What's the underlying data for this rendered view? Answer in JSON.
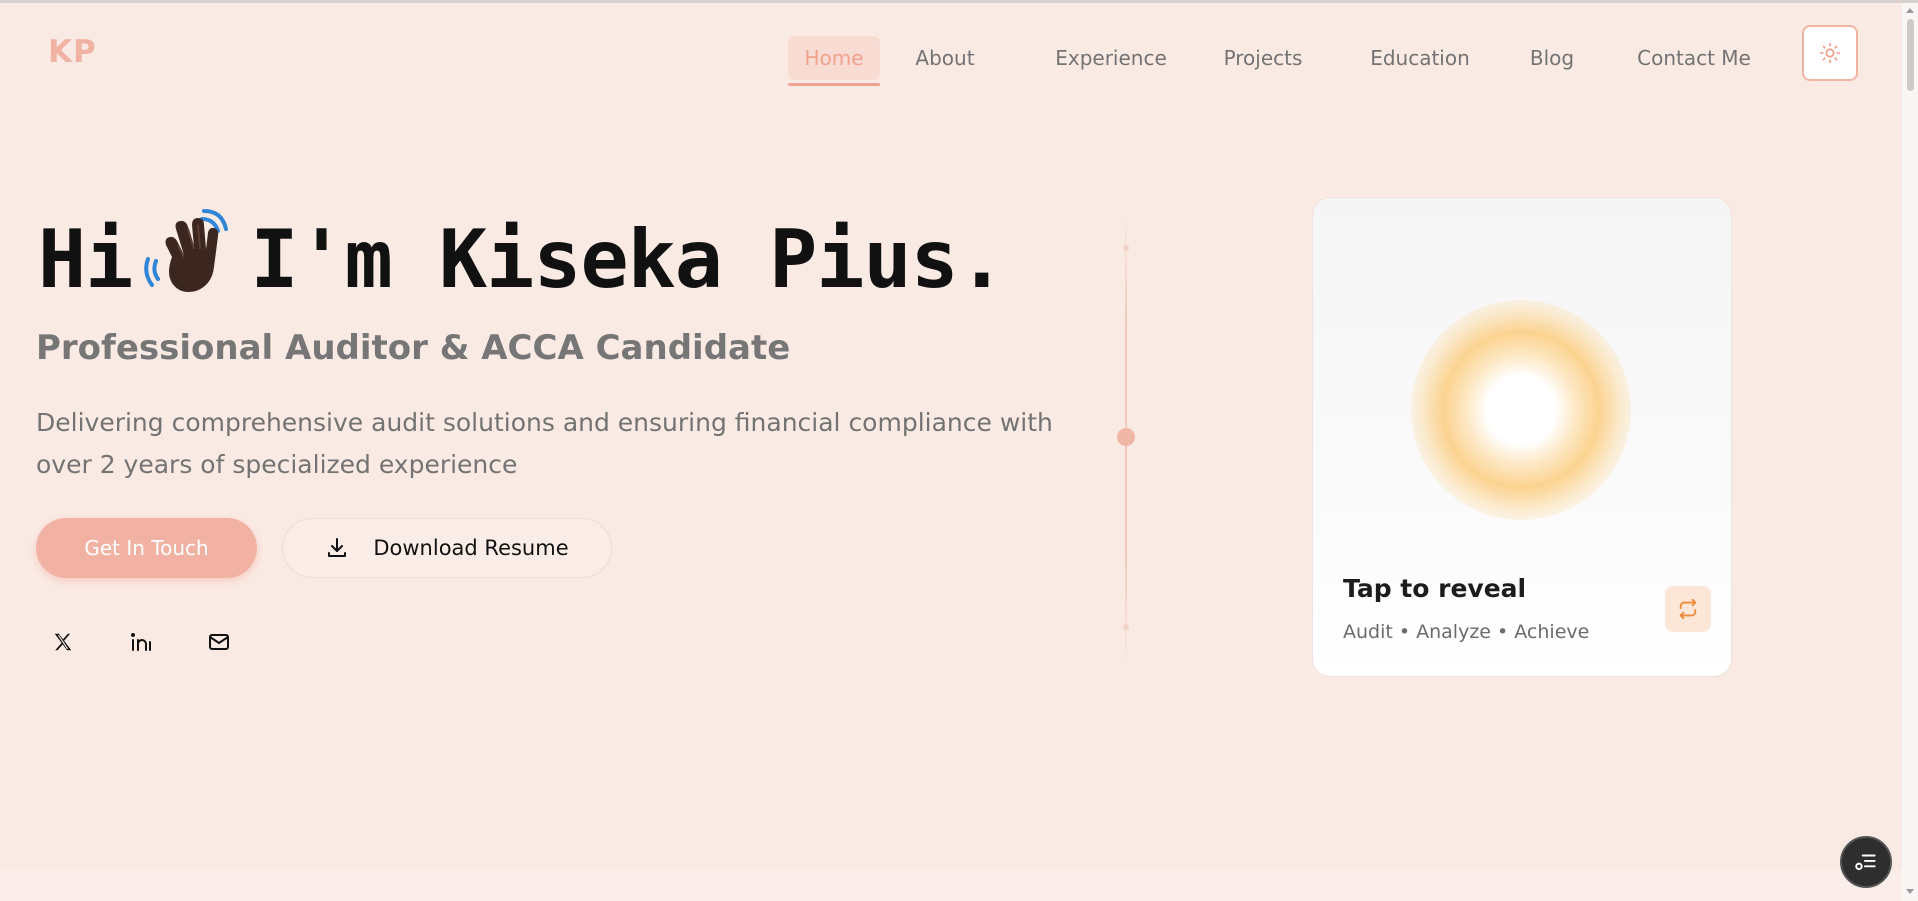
{
  "header": {
    "logo": "KP",
    "nav": [
      {
        "label": "Home",
        "active": true
      },
      {
        "label": "About"
      },
      {
        "label": "Experience"
      },
      {
        "label": "Projects"
      },
      {
        "label": "Education"
      },
      {
        "label": "Blog"
      },
      {
        "label": "Contact Me"
      }
    ],
    "theme_icon": "sun-icon"
  },
  "hero": {
    "greeting": "Hi",
    "emoji_icon": "waving-hand-icon",
    "name": "I'm Kiseka Pius.",
    "subtitle": "Professional Auditor & ACCA Candidate",
    "description": "Delivering comprehensive audit solutions and ensuring financial compliance with over 2 years of specialized experience",
    "primary_button": "Get In Touch",
    "secondary_button": "Download Resume",
    "socials": [
      "x-icon",
      "linkedin-icon",
      "mail-icon"
    ]
  },
  "card": {
    "title": "Tap to reveal",
    "subtitle": "Audit • Analyze • Achieve",
    "flip_icon": "repeat-icon"
  },
  "colors": {
    "background": "#faeae4",
    "accent": "#f2b2a3",
    "accent_text": "#f0a290"
  }
}
